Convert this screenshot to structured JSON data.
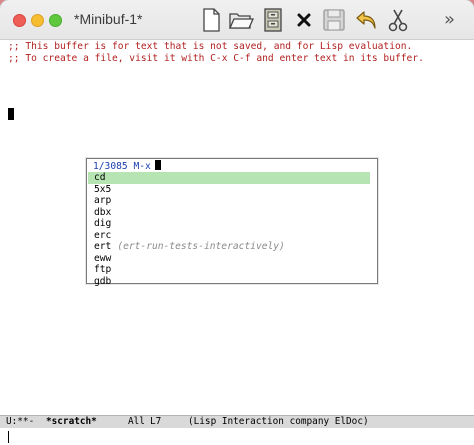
{
  "window": {
    "title": "*Minibuf-1*"
  },
  "toolbar": {
    "items": [
      {
        "name": "new-file",
        "icon": "new-file-icon"
      },
      {
        "name": "open-folder",
        "icon": "open-folder-icon"
      },
      {
        "name": "file-cabinet",
        "icon": "file-cabinet-icon"
      },
      {
        "name": "kill-buffer",
        "icon": "close-x-icon"
      },
      {
        "name": "save",
        "icon": "save-disk-icon"
      },
      {
        "name": "undo",
        "icon": "undo-arrow-icon"
      },
      {
        "name": "cut",
        "icon": "scissors-icon"
      }
    ],
    "overflow": "»"
  },
  "buffer": {
    "lines": [
      ";; This buffer is for text that is not saved, and for Lisp evaluation.",
      ";; To create a file, visit it with C-x C-f and enter text in its buffer."
    ]
  },
  "completion": {
    "count": "1/3085",
    "prompt": "M-x",
    "candidates": [
      {
        "text": "cd",
        "annotation": "",
        "selected": true
      },
      {
        "text": "5x5",
        "annotation": "",
        "selected": false
      },
      {
        "text": "arp",
        "annotation": "",
        "selected": false
      },
      {
        "text": "dbx",
        "annotation": "",
        "selected": false
      },
      {
        "text": "dig",
        "annotation": "",
        "selected": false
      },
      {
        "text": "erc",
        "annotation": "",
        "selected": false
      },
      {
        "text": "ert",
        "annotation": "(ert-run-tests-interactively)",
        "selected": false
      },
      {
        "text": "eww",
        "annotation": "",
        "selected": false
      },
      {
        "text": "ftp",
        "annotation": "",
        "selected": false
      },
      {
        "text": "gdb",
        "annotation": "",
        "selected": false
      }
    ]
  },
  "modeline": {
    "status": "U:**-",
    "buffer_name": "*scratch*",
    "position": "All",
    "line": "L7",
    "modes": "(Lisp Interaction company ElDoc)"
  },
  "colors": {
    "comment": "#b22222",
    "selection": "#b7e4b3",
    "prompt": "#1a3fb0",
    "modeline_bg": "#d9d9d9"
  }
}
